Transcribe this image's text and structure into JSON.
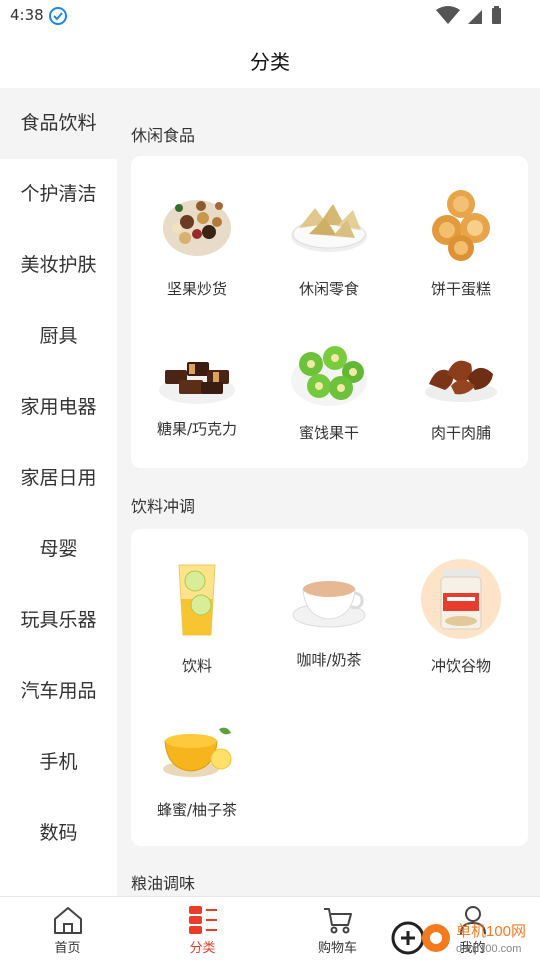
{
  "status": {
    "time": "4:38"
  },
  "header": {
    "title": "分类"
  },
  "sidebar": {
    "items": [
      {
        "label": "食品饮料",
        "active": true
      },
      {
        "label": "个护清洁"
      },
      {
        "label": "美妆护肤"
      },
      {
        "label": "厨具"
      },
      {
        "label": "家用电器"
      },
      {
        "label": "家居日用"
      },
      {
        "label": "母婴"
      },
      {
        "label": "玩具乐器"
      },
      {
        "label": "汽车用品"
      },
      {
        "label": "手机"
      },
      {
        "label": "数码"
      }
    ]
  },
  "sections": [
    {
      "title": "休闲食品",
      "items": [
        {
          "label": "坚果炒货",
          "icon": "nuts-image"
        },
        {
          "label": "休闲零食",
          "icon": "chips-image"
        },
        {
          "label": "饼干蛋糕",
          "icon": "cookies-image"
        },
        {
          "label": "糖果/巧克力",
          "icon": "chocolate-image"
        },
        {
          "label": "蜜饯果干",
          "icon": "dried-kiwi-image"
        },
        {
          "label": "肉干肉脯",
          "icon": "jerky-image"
        }
      ]
    },
    {
      "title": "饮料冲调",
      "items": [
        {
          "label": "饮料",
          "icon": "lemon-drink-image"
        },
        {
          "label": "咖啡/奶茶",
          "icon": "milk-tea-image"
        },
        {
          "label": "冲饮谷物",
          "icon": "oats-jar-image"
        },
        {
          "label": "蜂蜜/柚子茶",
          "icon": "honey-citron-image"
        }
      ]
    },
    {
      "title": "粮油调味"
    }
  ],
  "tabbar": [
    {
      "label": "首页",
      "icon": "home-icon"
    },
    {
      "label": "分类",
      "icon": "category-icon",
      "active": true
    },
    {
      "label": "购物车",
      "icon": "cart-icon"
    },
    {
      "label": "我的",
      "icon": "user-icon"
    }
  ],
  "watermark": {
    "text": "单机100网",
    "sub": "danji100.com"
  },
  "colors": {
    "accent": "#e93d2a",
    "background": "#f4f4f4",
    "card": "#ffffff"
  }
}
